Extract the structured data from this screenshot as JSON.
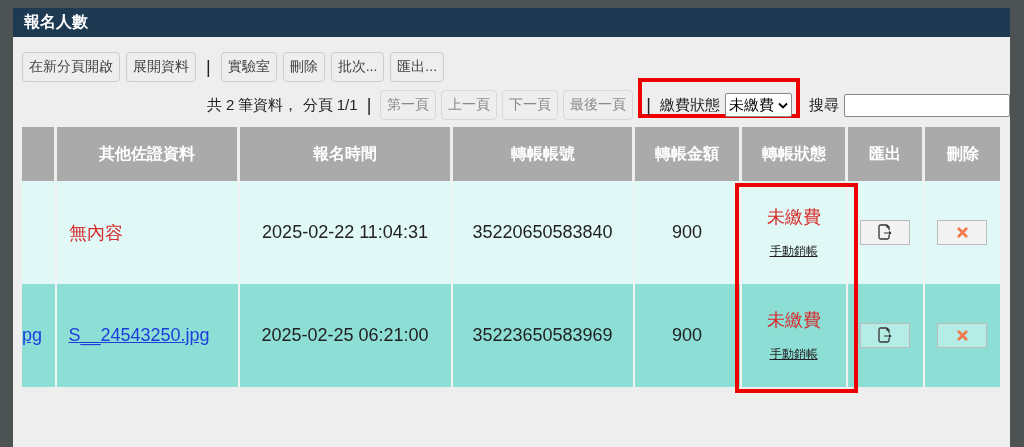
{
  "window": {
    "title": "報名人數"
  },
  "toolbar": {
    "buttons": [
      {
        "label": "在新分頁開啟",
        "kind": "button"
      },
      {
        "label": "展開資料",
        "kind": "button"
      },
      {
        "label": "|",
        "kind": "separator"
      },
      {
        "label": "實驗室",
        "kind": "button"
      },
      {
        "label": "刪除",
        "kind": "button"
      },
      {
        "label": "批次...",
        "kind": "button"
      },
      {
        "label": "匯出...",
        "kind": "button"
      }
    ]
  },
  "pager": {
    "summary": "共 2 筆資料， 分頁 1/1",
    "separator": "|",
    "buttons": [
      {
        "label": "第一頁",
        "disabled": true
      },
      {
        "label": "上一頁",
        "disabled": true
      },
      {
        "label": "下一頁",
        "disabled": true
      },
      {
        "label": "最後一頁",
        "disabled": true
      }
    ]
  },
  "filter": {
    "separator": "|",
    "label": "繳費狀態",
    "value": "未繳費",
    "search_label": "搜尋"
  },
  "table": {
    "columns": [
      "",
      "其他佐證資料",
      "報名時間",
      "轉帳帳號",
      "轉帳金額",
      "轉帳狀態",
      "匯出",
      "刪除"
    ],
    "rows": [
      {
        "selected": false,
        "column_1": "",
        "evidence": {
          "text": "無內容",
          "kind": "empty"
        },
        "time": "2025-02-22 11:04:31",
        "account": "35220650583840",
        "amount": "900",
        "status": "未繳費",
        "action": "手動銷帳"
      },
      {
        "selected": true,
        "column_1": "pg",
        "evidence": {
          "text": "S__24543250.jpg",
          "kind": "link"
        },
        "time": "2025-02-25 06:21:00",
        "account": "35223650583969",
        "amount": "900",
        "status": "未繳費",
        "action": "手動銷帳"
      }
    ]
  }
}
